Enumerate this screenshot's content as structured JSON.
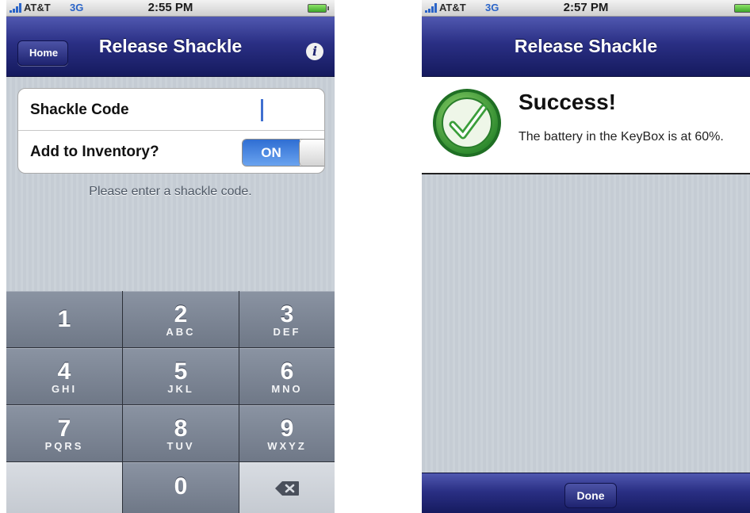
{
  "left": {
    "status": {
      "carrier": "AT&T",
      "network": "3G",
      "time": "2:55 PM"
    },
    "nav": {
      "back_label": "Home",
      "title": "Release Shackle",
      "info_icon": "info-icon"
    },
    "form": {
      "shackle_label": "Shackle Code",
      "shackle_value": "",
      "inventory_label": "Add to Inventory?",
      "inventory_toggle_label": "ON",
      "inventory_on": true
    },
    "hint": "Please enter a shackle code.",
    "keypad": {
      "k1": {
        "digit": "1",
        "letters": ""
      },
      "k2": {
        "digit": "2",
        "letters": "ABC"
      },
      "k3": {
        "digit": "3",
        "letters": "DEF"
      },
      "k4": {
        "digit": "4",
        "letters": "GHI"
      },
      "k5": {
        "digit": "5",
        "letters": "JKL"
      },
      "k6": {
        "digit": "6",
        "letters": "MNO"
      },
      "k7": {
        "digit": "7",
        "letters": "PQRS"
      },
      "k8": {
        "digit": "8",
        "letters": "TUV"
      },
      "k9": {
        "digit": "9",
        "letters": "WXYZ"
      },
      "k0": {
        "digit": "0",
        "letters": ""
      },
      "delete_icon": "backspace-icon"
    }
  },
  "right": {
    "status": {
      "carrier": "AT&T",
      "network": "3G",
      "time": "2:57 PM"
    },
    "nav": {
      "title": "Release Shackle"
    },
    "result": {
      "icon": "checkmark-icon",
      "title": "Success!",
      "message": "The battery in the KeyBox is at 60%."
    },
    "toolbar": {
      "done_label": "Done"
    }
  },
  "colors": {
    "nav_dark": "#151a5e",
    "nav_light": "#5058b0",
    "toggle_blue": "#2f6ed3",
    "network_blue": "#2a64c8",
    "check_green": "#3a9e3a"
  }
}
